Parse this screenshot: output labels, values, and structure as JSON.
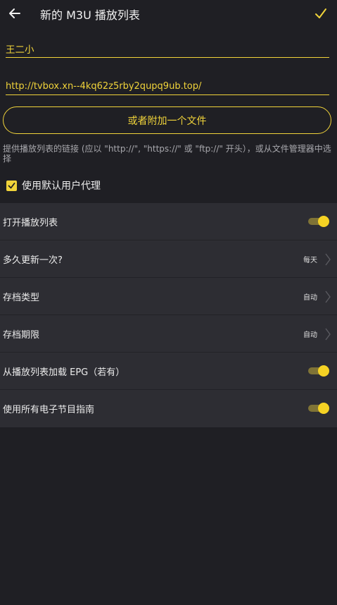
{
  "header": {
    "title": "新的 M3U 播放列表"
  },
  "form": {
    "name_value": "王二小",
    "url_value": "http://tvbox.xn--4kq62z5rby2qupq9ub.top/",
    "attach_label": "或者附加一个文件",
    "hint": "提供播放列表的链接 (应以 \"http://\", \"https://\" 或 \"ftp://\" 开头），或从文件管理器中选择",
    "default_ua_label": "使用默认用户代理",
    "default_ua_checked": true
  },
  "settings": {
    "open_playlist": {
      "label": "打开播放列表",
      "on": true
    },
    "update_freq": {
      "label": "多久更新一次?",
      "value": "每天"
    },
    "archive_type": {
      "label": "存档类型",
      "value": "自动"
    },
    "archive_period": {
      "label": "存档期限",
      "value": "自动"
    },
    "load_epg": {
      "label": "从播放列表加载 EPG（若有）",
      "on": true
    },
    "use_all_epg": {
      "label": "使用所有电子节目指南",
      "on": true
    }
  },
  "colors": {
    "accent": "#f0d33a",
    "background": "#1f1f24",
    "panel": "#2d2d33"
  }
}
